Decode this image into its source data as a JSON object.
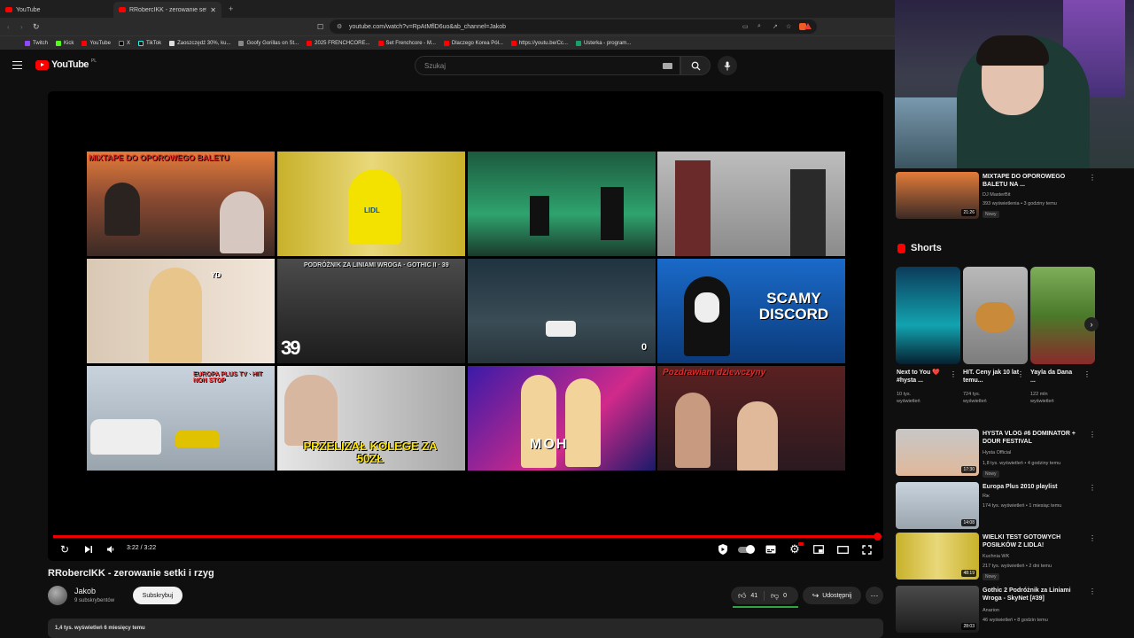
{
  "browser": {
    "tabs": [
      {
        "label": "YouTube"
      },
      {
        "label": "RRobercIKK - zerowanie setki i rz..."
      }
    ],
    "url": "youtube.com/watch?v=RpAtMflD6uo&ab_channel=Jakob",
    "bookmarks": [
      "Twitch",
      "Kick",
      "YouTube",
      "X",
      "TikTok",
      "Zaoszczędź 30%, ku...",
      "Goofy Gorillas on St...",
      "2025 FRENCHCORE...",
      "Set Frenchcore - M...",
      "Dlaczego Korea Pół...",
      "https://youtu.be/Cc...",
      "Usterka - program..."
    ]
  },
  "youtube": {
    "logo_text": "YouTube",
    "region": "PL",
    "search_placeholder": "Szukaj"
  },
  "player": {
    "time": "3:22 / 3:22",
    "progress": 1.0,
    "endscreen": [
      {
        "caption": "MIXTAPE DO OPOROWEGO BALETU"
      },
      {
        "caption": "LIDL"
      },
      {
        "caption": ""
      },
      {
        "caption": ""
      },
      {
        "caption": "YD"
      },
      {
        "caption": "PODRÓŻNIK ZA LINIAMI WROGA · GOTHIC II · 39"
      },
      {
        "caption": "0"
      },
      {
        "caption": "SCAMY DISCORD"
      },
      {
        "caption": "EUROPA PLUS TV · HIT NON STOP"
      },
      {
        "caption": "PRZELIZAŁ KOLEGE ZA 50ZŁ"
      },
      {
        "caption": "MOH"
      },
      {
        "caption": "Pozdrawiam dziewczyny"
      }
    ]
  },
  "video": {
    "title": "RRobercIKK - zerowanie setki i rzyg",
    "channel": "Jakob",
    "subscribers": "9 subskrybentów",
    "subscribe_label": "Subskrybuj",
    "likes": "41",
    "dislikes": "0",
    "share_label": "Udostępnij",
    "description_preview": "1,4 tys. wyświetleń  6 miesięcy temu"
  },
  "sidebar": {
    "top": {
      "title": "MIXTAPE DO OPOROWEGO BALETU NA ...",
      "channel": "DJ MasterBit",
      "meta": "393 wyświetlenia • 3 godziny temu",
      "badge": "Nowy",
      "duration": "21:26"
    },
    "shorts_heading": "Shorts",
    "shorts": [
      {
        "title": "Next to You ❤️ #hysta ...",
        "views": "10 tys. wyświetleń"
      },
      {
        "title": "HIT. Ceny jak 10 lat temu...",
        "views": "724 tys. wyświetleń"
      },
      {
        "title": "Yayla da Dana ...",
        "views": "122 mln wyświetleń"
      }
    ],
    "videos": [
      {
        "title": "HYSTA VLOG #6 DOMINATOR + DOUR FESTIVAL",
        "channel": "Hysta Official",
        "meta": "1,8 tys. wyświetleń • 4 godziny temu",
        "badge": "Nowy",
        "duration": "17:30"
      },
      {
        "title": "Europa Plus 2010 playlist",
        "channel": "Rж",
        "meta": "174 tys. wyświetleń • 1 miesiąc temu",
        "badge": "",
        "duration": "14:08"
      },
      {
        "title": "WIELKI TEST GOTOWYCH POSIŁKÓW Z LIDLA!",
        "channel": "Kuchnia WK",
        "meta": "217 tys. wyświetleń • 2 dni temu",
        "badge": "Nowy",
        "duration": "48:19"
      },
      {
        "title": "Gothic 2 Podróżnik za Liniami Wroga - SkyNet [#39]",
        "channel": "Anarion",
        "meta": "46 wyświetleń • 8 godzin temu",
        "badge": "",
        "duration": "28:03"
      }
    ]
  }
}
